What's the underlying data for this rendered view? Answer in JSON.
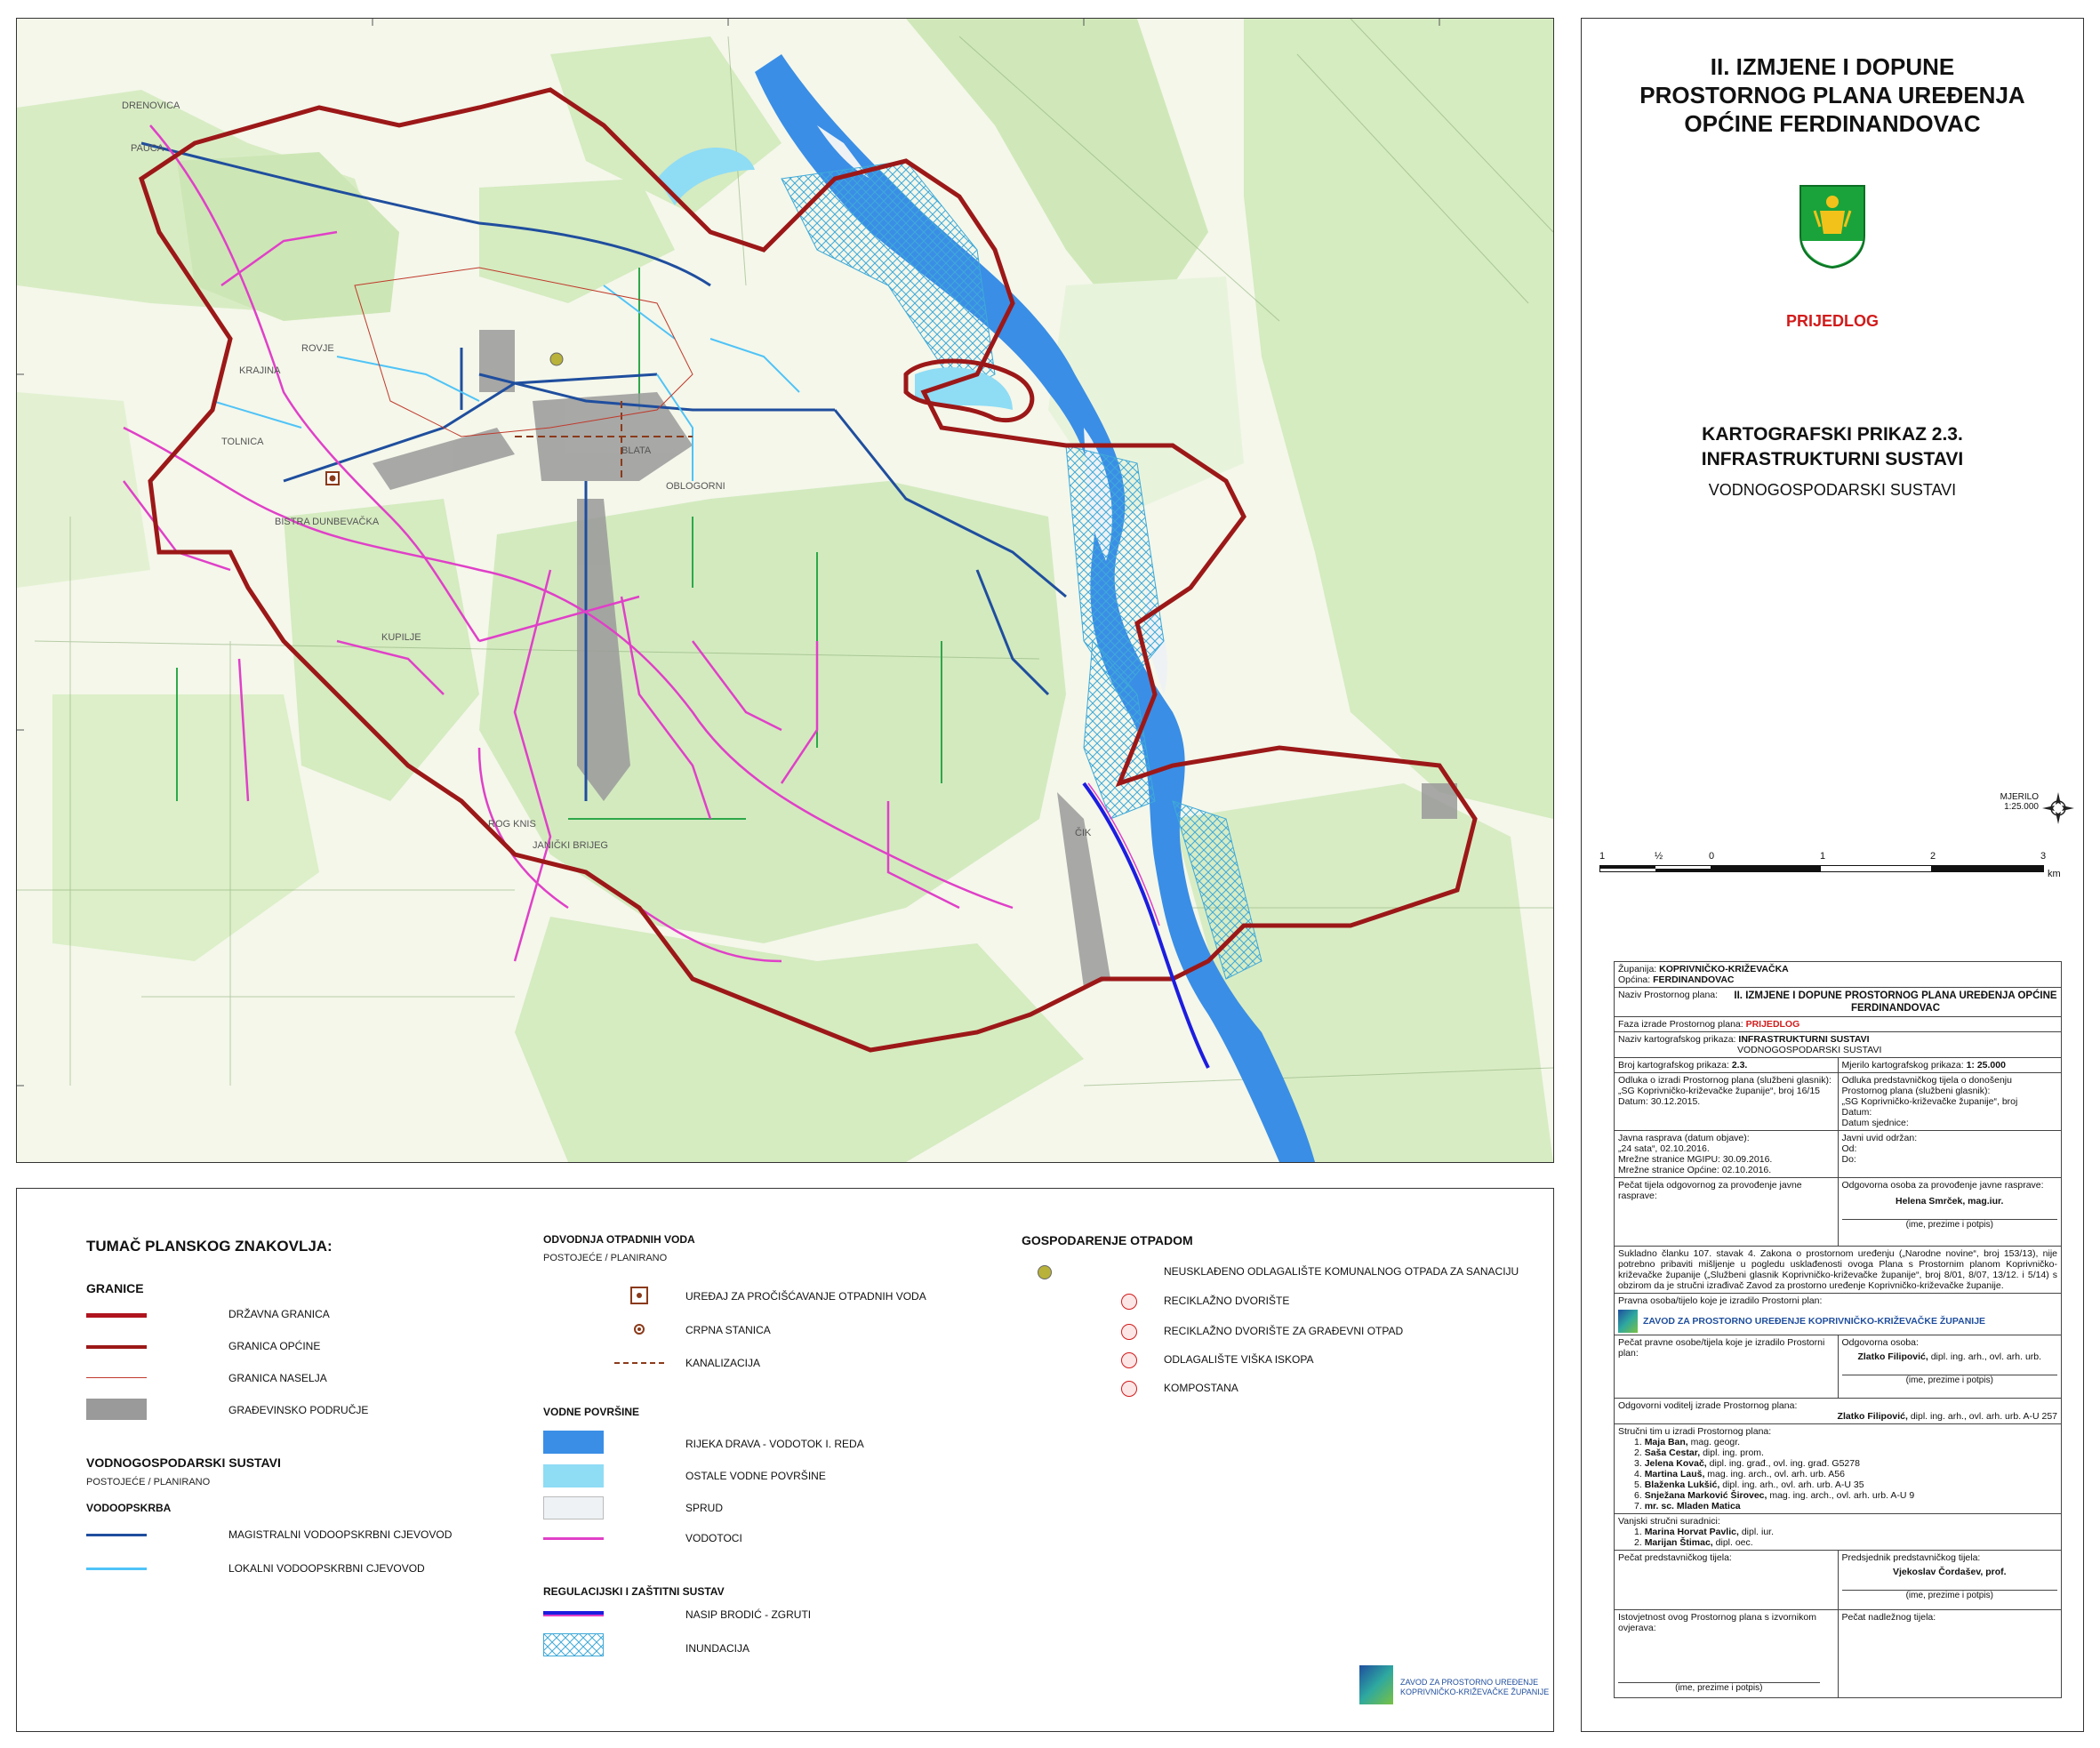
{
  "map": {
    "place_labels": [
      "DRENOVICA",
      "PAUCA",
      "KRAJINA",
      "ROVJE",
      "TOLNICA",
      "BISTRA DUNBEVAČKA",
      "BLATA",
      "OBLOGORNI",
      "KUPILJE",
      "ROG KNIS",
      "JANIČKI BRIJEG",
      "ČIK"
    ],
    "river_name": "Drava"
  },
  "legend": {
    "title": "TUMAČ PLANSKOG ZNAKOVLJA:",
    "granice": {
      "heading": "GRANICE",
      "items": [
        {
          "label": "DRŽAVNA GRANICA",
          "color": "#b0141e"
        },
        {
          "label": "GRANICA OPĆINE",
          "color": "#9c1818"
        },
        {
          "label": "GRANICA NASELJA",
          "color": "#c0392b"
        },
        {
          "label": "GRAĐEVINSKO PODRUČJE",
          "color": "#9a9a9a"
        }
      ]
    },
    "vodno": {
      "heading": "VODNOGOSPODARSKI SUSTAVI",
      "sub": "POSTOJEĆE / PLANIRANO",
      "group": "VODOOPSKRBA",
      "items": [
        {
          "label": "MAGISTRALNI VODOOPSKRBNI CJEVOVOD",
          "color": "#1f4e9e"
        },
        {
          "label": "LOKALNI VODOOPSKRBNI CJEVOVOD",
          "color": "#4fc3f7"
        }
      ]
    },
    "odvodnja": {
      "heading": "ODVODNJA OTPADNIH VODA",
      "sub": "POSTOJEĆE / PLANIRANO",
      "items": [
        {
          "label": "UREĐAJ ZA PROČIŠĆAVANJE OTPADNIH VODA"
        },
        {
          "label": "CRPNA STANICA"
        },
        {
          "label": "KANALIZACIJA"
        }
      ]
    },
    "vodne": {
      "heading": "VODNE POVRŠINE",
      "items": [
        {
          "label": "RIJEKA DRAVA - VODOTOK I. REDA",
          "color": "#3a8ee6"
        },
        {
          "label": "OSTALE VODNE POVRŠINE",
          "color": "#8fdcf5"
        },
        {
          "label": "SPRUD",
          "color": "#eef2f5"
        },
        {
          "label": "VODOTOCI",
          "color": "#e040c8"
        }
      ]
    },
    "regulacija": {
      "heading": "REGULACIJSKI I ZAŠTITNI SUSTAV",
      "items": [
        {
          "label": "NASIP BRODIĆ - ZGRUTI"
        },
        {
          "label": "INUNDACIJA"
        }
      ]
    },
    "otpad": {
      "heading": "GOSPODARENJE OTPADOM",
      "items": [
        {
          "label": "NEUSKLAĐENO ODLAGALIŠTE KOMUNALNOG OTPADA ZA SANACIJU"
        },
        {
          "label": "RECIKLAŽNO DVORIŠTE"
        },
        {
          "label": "RECIKLAŽNO DVORIŠTE ZA GRAĐEVNI OTPAD"
        },
        {
          "label": "ODLAGALIŠTE VIŠKA ISKOPA"
        },
        {
          "label": "KOMPOSTANA"
        }
      ]
    },
    "institute_logo": {
      "line1": "ZAVOD ZA PROSTORNO UREĐENJE",
      "line2": "KOPRIVNIČKO-KRIŽEVAČKE ŽUPANIJE"
    }
  },
  "panel": {
    "title_lines": [
      "II. IZMJENE I DOPUNE",
      "PROSTORNOG PLANA UREĐENJA",
      "OPĆINE FERDINANDOVAC"
    ],
    "status": "PRIJEDLOG",
    "map_title_lines": [
      "KARTOGRAFSKI PRIKAZ 2.3.",
      "INFRASTRUKTURNI SUSTAVI"
    ],
    "map_subtitle": "VODNOGOSPODARSKI SUSTAVI",
    "scale_label": "MJERILO",
    "scale_ratio": "1:25.000",
    "scale_ticks": [
      "1",
      "½",
      "0",
      "1",
      "2",
      "3"
    ],
    "scale_unit": "km",
    "accent_color": "#d21b1b"
  },
  "table": {
    "zupanija_label": "Županija:",
    "zupanija": "KOPRIVNIČKO-KRIŽEVAČKA",
    "opcina_label": "Općina:",
    "opcina": "FERDINANDOVAC",
    "naziv_plana_label": "Naziv Prostornog plana:",
    "naziv_plana": "II. IZMJENE I DOPUNE PROSTORNOG PLANA UREĐENJA OPĆINE FERDINANDOVAC",
    "faza_label": "Faza izrade Prostornog plana:",
    "faza": "PRIJEDLOG",
    "naziv_prikaza_label": "Naziv kartografskog prikaza:",
    "naziv_prikaza": "INFRASTRUKTURNI SUSTAVI",
    "naziv_prikaza_sub": "VODNOGOSPODARSKI SUSTAVI",
    "broj_label": "Broj kartografskog prikaza:",
    "broj": "2.3.",
    "mjerilo_label": "Mjerilo kartografskog prikaza:",
    "mjerilo": "1: 25.000",
    "odluka_izradi": "Odluka o izradi Prostornog plana (službeni glasnik):",
    "odluka_izradi_val": "„SG Koprivničko-križevačke županije“, broj 16/15",
    "odluka_izradi_date": "Datum: 30.12.2015.",
    "odluka_donosenju": "Odluka predstavničkog tijela o donošenju Prostornog plana (službeni glasnik):",
    "odluka_donosenju_val": "„SG Koprivničko-križevačke županije“, broj",
    "odluka_donosenju_date": "Datum:",
    "odluka_donosenju_sjednica": "Datum sjednice:",
    "rasprava": "Javna rasprava (datum objave):",
    "rasprava_val": "„24 sata“, 02.10.2016.",
    "rasprava_mgipu": "Mrežne stranice MGIPU: 30.09.2016.",
    "rasprava_opcina": "Mrežne stranice Općine: 02.10.2016.",
    "uvid": "Javni uvid održan:",
    "uvid_od": "Od:",
    "uvid_do": "Do:",
    "pecat_rasprave": "Pečat tijela odgovornog za provođenje javne rasprave:",
    "odgovorna_rasprava": "Odgovorna osoba za provođenje javne rasprave:",
    "odgovorna_rasprava_name": "Helena Smrček, mag.iur.",
    "ime_potpis": "(ime, prezime i potpis)",
    "suglasnost": "Sukladno članku 107. stavak 4. Zakona o prostornom uređenju („Narodne novine“, broj 153/13), nije potrebno pribaviti mišljenje u pogledu usklađenosti ovoga Plana s Prostornim planom Koprivničko-križevačke županije („Službeni glasnik Koprivničko-križevačke županije“, broj 8/01, 8/07, 13/12. i 5/14) s obzirom da je stručni izrađivač Zavod za prostorno uređenje Koprivničko-križevačke županije.",
    "pravna_osoba": "Pravna osoba/tijelo koje je izradilo Prostorni plan:",
    "pravna_osoba_name": "ZAVOD ZA PROSTORNO UREĐENJE KOPRIVNIČKO-KRIŽEVAČKE ŽUPANIJE",
    "pecat_pravne": "Pečat pravne osobe/tijela koje je izradilo Prostorni plan:",
    "odgovorna_osoba": "Odgovorna osoba:",
    "odgovorna_osoba_name": "Zlatko Filipović,",
    "odgovorna_osoba_title": "dipl. ing. arh., ovl. arh. urb.",
    "voditelj": "Odgovorni voditelj izrade Prostornog plana:",
    "voditelj_name": "Zlatko Filipović,",
    "voditelj_title": "dipl. ing. arh., ovl. arh. urb. A-U 257",
    "strucni_tim": "Stručni tim u izradi Prostornog plana:",
    "members": [
      {
        "n": "1.",
        "name": "Maja Ban,",
        "title": "mag. geogr."
      },
      {
        "n": "2.",
        "name": "Saša Cestar,",
        "title": "dipl. ing. prom."
      },
      {
        "n": "3.",
        "name": "Jelena Kovač,",
        "title": "dipl. ing. građ., ovl. ing. građ. G5278"
      },
      {
        "n": "4.",
        "name": "Martina Lauš,",
        "title": "mag. ing. arch., ovl. arh. urb. A56"
      },
      {
        "n": "5.",
        "name": "Blaženka Lukšić,",
        "title": "dipl. ing. arh., ovl. arh. urb. A-U 35"
      },
      {
        "n": "6.",
        "name": "Snježana Marković Širovec,",
        "title": "mag. ing. arch., ovl. arh. urb. A-U 9"
      },
      {
        "n": "7.",
        "name": "mr. sc. Mladen Matica",
        "title": ""
      }
    ],
    "vanjski": "Vanjski stručni suradnici:",
    "vanjski_members": [
      {
        "n": "1.",
        "name": "Marina Horvat Pavlic,",
        "title": "dipl. iur."
      },
      {
        "n": "2.",
        "name": "Marijan Štimac,",
        "title": "dipl. oec."
      }
    ],
    "pecat_predstavnickog": "Pečat predstavničkog tijela:",
    "predsjednik": "Predsjednik predstavničkog tijela:",
    "predsjednik_name": "Vjekoslav Čordašev, prof.",
    "istovjetnost": "Istovjetnost ovog Prostornog plana s izvornikom ovjerava:",
    "pecat_nadleznog": "Pečat nadležnog tijela:"
  }
}
